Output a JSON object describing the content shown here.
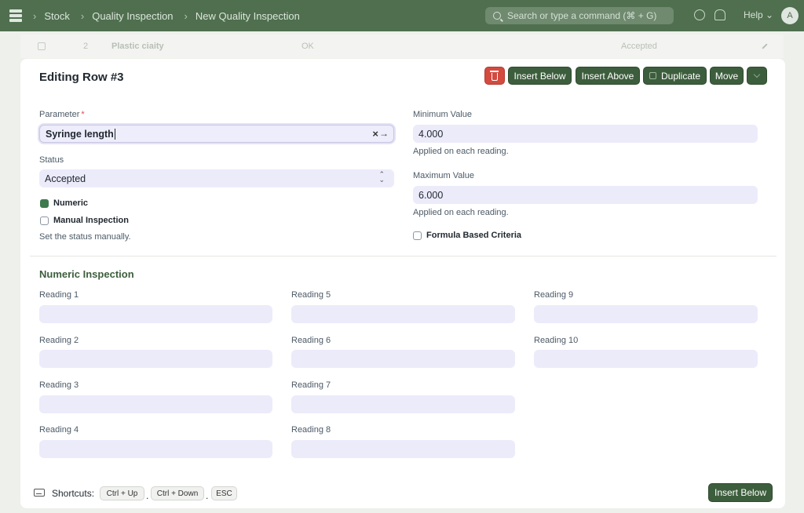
{
  "navbar": {
    "breadcrumbs": [
      "Stock",
      "Quality Inspection",
      "New Quality Inspection"
    ],
    "search_placeholder": "Search or type a command (⌘ + G)",
    "help_label": "Help",
    "avatar_initial": "A"
  },
  "background_row": {
    "index": "2",
    "parameter": "Plastic ciaity",
    "value": "OK",
    "status": "Accepted"
  },
  "panel": {
    "title": "Editing Row #3",
    "buttons": {
      "insert_below": "Insert Below",
      "insert_above": "Insert Above",
      "duplicate": "Duplicate",
      "move": "Move"
    },
    "parameter": {
      "label": "Parameter",
      "value": "Syringe length"
    },
    "status": {
      "label": "Status",
      "value": "Accepted"
    },
    "numeric": {
      "label": "Numeric",
      "checked": true
    },
    "manual_inspection": {
      "label": "Manual Inspection",
      "checked": false,
      "hint": "Set the status manually."
    },
    "minimum_value": {
      "label": "Minimum Value",
      "value": "4.000",
      "hint": "Applied on each reading."
    },
    "maximum_value": {
      "label": "Maximum Value",
      "value": "6.000",
      "hint": "Applied on each reading."
    },
    "formula_based": {
      "label": "Formula Based Criteria",
      "checked": false
    },
    "section_title": "Numeric Inspection",
    "readings": [
      "Reading 1",
      "Reading 2",
      "Reading 3",
      "Reading 4",
      "Reading 5",
      "Reading 6",
      "Reading 7",
      "Reading 8",
      "Reading 9",
      "Reading 10"
    ],
    "footer": {
      "shortcuts_label": "Shortcuts:",
      "keys": [
        "Ctrl + Up",
        "Ctrl + Down",
        "ESC"
      ],
      "separator": ".",
      "insert_below": "Insert Below"
    }
  },
  "colors": {
    "primary": "#3d5e3d",
    "danger": "#d34a3f",
    "input_bg": "#ecebfa",
    "checkbox_checked": "#3d7a4d"
  }
}
